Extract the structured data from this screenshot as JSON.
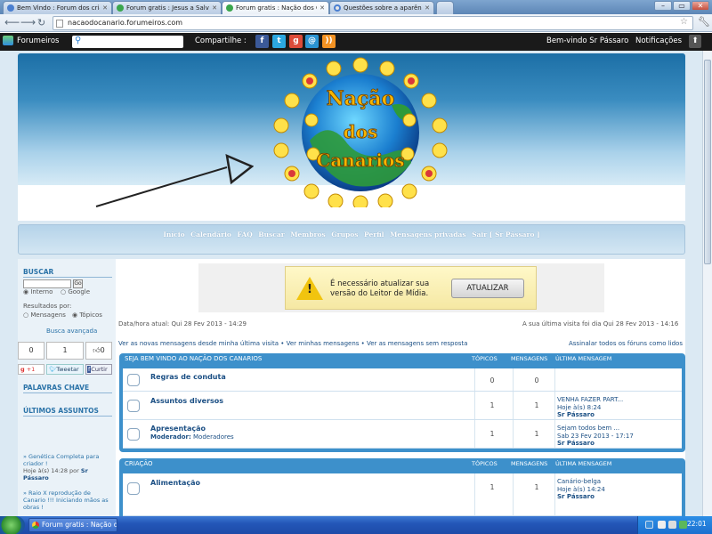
{
  "browser": {
    "tabs": [
      {
        "label": "Bem Vindo : Forum dos criad",
        "active": false
      },
      {
        "label": "Forum gratis : Jesus a Salva",
        "active": false
      },
      {
        "label": "Forum gratis : Nação dos Ca",
        "active": true
      },
      {
        "label": "Questões sobre a aparênci",
        "active": false
      }
    ],
    "url": "nacaodocanario.forumeiros.com",
    "window_buttons": {
      "minimize": "–",
      "maximize": "▭",
      "close": "✕"
    }
  },
  "forumeiros_bar": {
    "brand": "Forumeiros",
    "share_label": "Compartilhe :",
    "welcome": "Bem-vindo Sr Pássaro",
    "notifications": "Notificações"
  },
  "header": {
    "logo_lines": [
      "Nação",
      "dos",
      "Canarios"
    ]
  },
  "nav": {
    "items": [
      "Início",
      "Calendário",
      "FAQ",
      "Buscar",
      "Membros",
      "Grupos",
      "Perfil",
      "Mensagens privadas",
      "Sair [ Sr Pássaro ]"
    ]
  },
  "sidebar": {
    "search_title": "BUSCAR",
    "search_go": "Go",
    "opt_internal": "Interno",
    "opt_google": "Google",
    "results_label": "Resultados por:",
    "opt_messages": "Mensagens",
    "opt_topics": "Tópicos",
    "advanced": "Busca avançada",
    "counts": [
      "0",
      "1",
      "0"
    ],
    "gplus": "+1",
    "tweet": "Tweetar",
    "fb": "Curtir",
    "keywords_title": "PALAVRAS CHAVE",
    "latest_title": "ÚLTIMOS ASSUNTOS",
    "latest_1": "» Genética Completa para criador !",
    "latest_1_meta": "Hoje à(s) 14:28 por",
    "latest_1_user": "Sr Pássaro",
    "latest_2": "» Raio X reprodução de Canario !!! Iniciando mãos as obras !"
  },
  "ad": {
    "message": "É necessário atualizar sua versão do Leitor de Mídia.",
    "button": "ATUALIZAR"
  },
  "info": {
    "datetime": "Data/hora atual: Qui 28 Fev 2013 - 14:29",
    "last_visit": "A sua última visita foi dia Qui 28 Fev 2013 - 14:16",
    "links_left": "Ver as novas mensagens desde minha última visita • Ver minhas mensagens • Ver as mensagens sem resposta",
    "link_right": "Assinalar todos os fóruns como lidos"
  },
  "columns": {
    "topics": "TÓPICOS",
    "messages": "MENSAGENS",
    "last": "ÚLTIMA MENSAGEM"
  },
  "categories": [
    {
      "title": "SEJA BEM VINDO AO NAÇÃO DOS CANARIOS",
      "forums": [
        {
          "name": "Regras de conduta",
          "topics": "0",
          "messages": "0",
          "last_title": "",
          "last_date": "",
          "last_user": "",
          "moderator_label": "",
          "moderator": ""
        },
        {
          "name": "Assuntos diversos",
          "topics": "1",
          "messages": "1",
          "last_title": "VENHA FAZER PART...",
          "last_date": "Hoje à(s) 8:24",
          "last_user": "Sr Pássaro",
          "moderator_label": "",
          "moderator": ""
        },
        {
          "name": "Apresentação",
          "topics": "1",
          "messages": "1",
          "last_title": "Sejam todos bem ...",
          "last_date": "Sab 23 Fev 2013 - 17:17",
          "last_user": "Sr Pássaro",
          "moderator_label": "Moderador:",
          "moderator": "Moderadores"
        }
      ]
    },
    {
      "title": "CRIAÇÃO",
      "forums": [
        {
          "name": "Alimentação",
          "topics": "1",
          "messages": "1",
          "last_title": "Canário-belga",
          "last_date": "Hoje à(s) 14:24",
          "last_user": "Sr Pássaro",
          "moderator_label": "",
          "moderator": ""
        }
      ]
    }
  ],
  "taskbar": {
    "item": "Forum gratis : Nação d...",
    "clock": "22:01"
  }
}
